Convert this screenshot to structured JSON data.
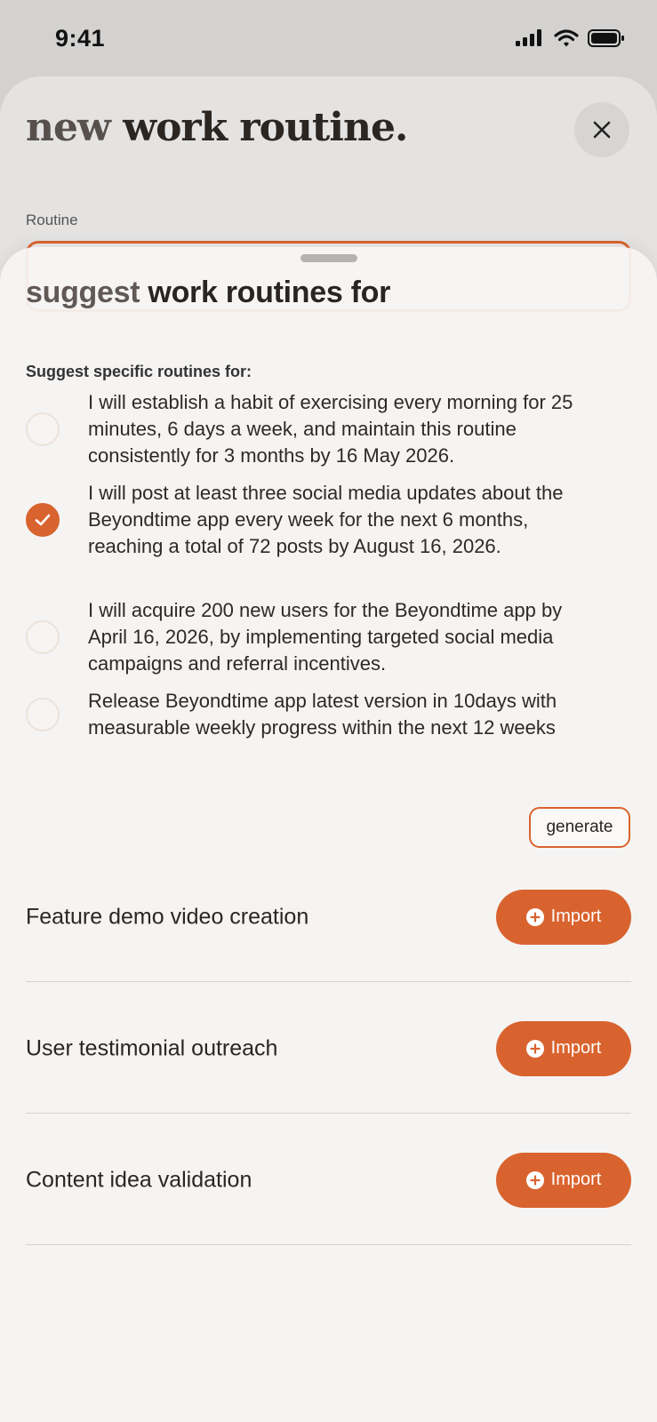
{
  "status_bar": {
    "time": "9:41"
  },
  "background_screen": {
    "title_part1": "new",
    "title_part2": "work routine.",
    "field_label": "Routine"
  },
  "sheet": {
    "title_part1": "suggest",
    "title_part2": "work routines for",
    "subheading": "Suggest specific routines for:",
    "options": [
      {
        "text": "I will establish a habit of exercising every morning for 25 minutes, 6 days a week, and maintain this routine consistently for 3 months by 16 May 2026.",
        "selected": false
      },
      {
        "text": "I will post at least three social media updates about the Beyondtime app every week for the next 6 months, reaching a total of 72 posts by August 16, 2026.",
        "selected": true
      },
      {
        "text": "I will acquire 200 new users for the Beyondtime app by April 16, 2026, by implementing targeted social media campaigns and referral incentives.",
        "selected": false
      },
      {
        "text": "Release Beyondtime app latest version in 10days with measurable weekly progress within the next 12 weeks",
        "selected": false
      }
    ],
    "generate_label": "generate",
    "suggestions": [
      {
        "name": "Feature demo video creation",
        "import_label": "Import"
      },
      {
        "name": "User testimonial outreach",
        "import_label": "Import"
      },
      {
        "name": "Content idea validation",
        "import_label": "Import"
      }
    ]
  },
  "colors": {
    "accent": "#d9632e",
    "background": "#d3d2d0",
    "sheet": "#f6f5f4"
  }
}
